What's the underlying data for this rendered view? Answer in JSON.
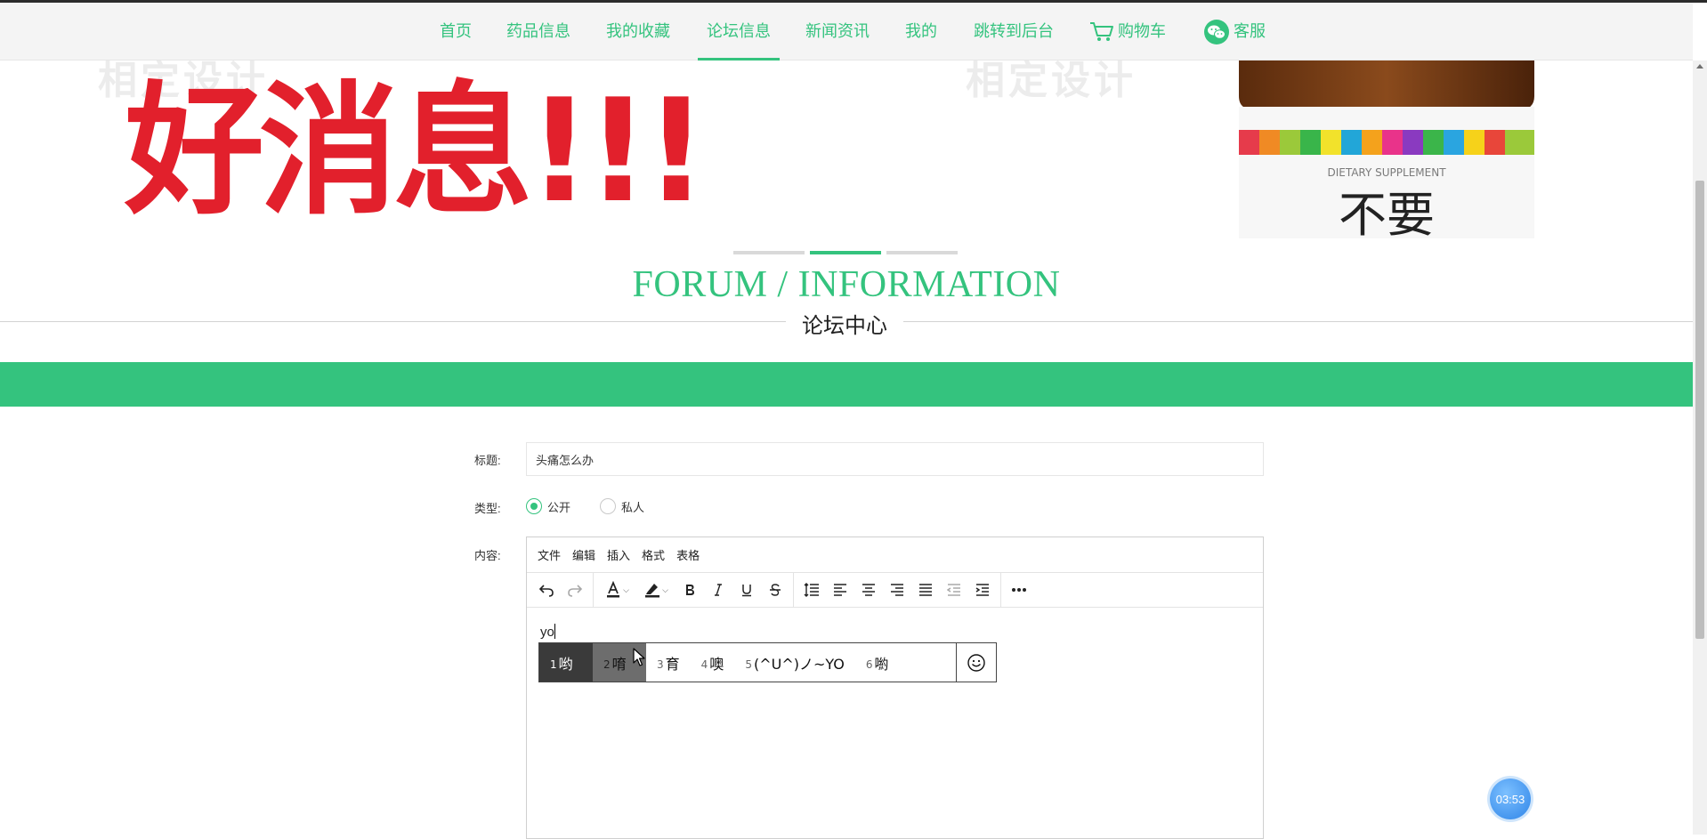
{
  "nav": {
    "items": [
      {
        "label": "首页"
      },
      {
        "label": "药品信息"
      },
      {
        "label": "我的收藏"
      },
      {
        "label": "论坛信息",
        "active": true
      },
      {
        "label": "新闻资讯"
      },
      {
        "label": "我的"
      },
      {
        "label": "跳转到后台"
      },
      {
        "label": "购物车",
        "icon": "cart-icon"
      },
      {
        "label": "客服",
        "icon": "wechat-icon"
      }
    ]
  },
  "banner": {
    "headline": "好消息!!!",
    "watermark_left": "相定设计",
    "watermark_right": "相定设计",
    "bottle_label_small": "DIETARY SUPPLEMENT",
    "bottle_label_big": "不要",
    "carousel_active_index": 1,
    "carousel_count": 3
  },
  "section": {
    "title_en": "FORUM / INFORMATION",
    "title_cn": "论坛中心"
  },
  "form": {
    "title_label": "标题:",
    "title_value": "头痛怎么办",
    "type_label": "类型:",
    "type_options": [
      {
        "label": "公开",
        "checked": true
      },
      {
        "label": "私人",
        "checked": false
      }
    ],
    "content_label": "内容:"
  },
  "editor": {
    "menus": [
      "文件",
      "编辑",
      "插入",
      "格式",
      "表格"
    ],
    "toolbar": [
      "undo-icon",
      "redo-icon",
      "font-color-icon",
      "highlight-icon",
      "bold-icon",
      "italic-icon",
      "underline-icon",
      "strikethrough-icon",
      "line-height-icon",
      "align-left-icon",
      "align-center-icon",
      "align-right-icon",
      "justify-icon",
      "outdent-icon",
      "indent-icon",
      "more-icon"
    ],
    "body_text": "yo"
  },
  "ime": {
    "candidates": [
      {
        "num": "1",
        "text": "哟"
      },
      {
        "num": "2",
        "text": "唷"
      },
      {
        "num": "3",
        "text": "育"
      },
      {
        "num": "4",
        "text": "噢"
      },
      {
        "num": "5",
        "text": "(^U^)ノ~YO"
      },
      {
        "num": "6",
        "text": "喲"
      }
    ],
    "selected_index": 0,
    "hover_index": 1
  },
  "timer": {
    "text": "03:53"
  },
  "colors": {
    "accent": "#34c37e",
    "banner_red": "#e2202c"
  }
}
